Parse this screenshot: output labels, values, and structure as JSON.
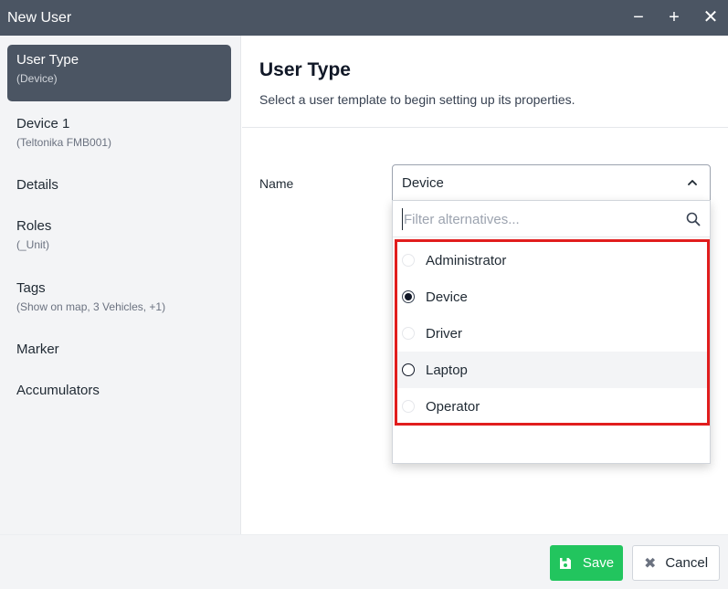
{
  "window": {
    "title": "New User",
    "minimize_label": "−",
    "maximize_label": "+",
    "close_label": "✕"
  },
  "sidebar": {
    "items": [
      {
        "label": "User Type",
        "sub": "(Device)"
      },
      {
        "label": "Device 1",
        "sub": "(Teltonika FMB001)"
      },
      {
        "label": "Details",
        "sub": ""
      },
      {
        "label": "Roles",
        "sub": "(_Unit)"
      },
      {
        "label": "Tags",
        "sub": "(Show on map, 3 Vehicles, +1)"
      },
      {
        "label": "Marker",
        "sub": ""
      },
      {
        "label": "Accumulators",
        "sub": ""
      }
    ]
  },
  "main": {
    "title": "User Type",
    "description": "Select a user template to begin setting up its properties.",
    "name_label": "Name",
    "select_value": "Device",
    "filter_placeholder": "Filter alternatives...",
    "options": [
      {
        "label": "Administrator",
        "state": "unselected"
      },
      {
        "label": "Device",
        "state": "selected"
      },
      {
        "label": "Driver",
        "state": "unselected"
      },
      {
        "label": "Laptop",
        "state": "hover"
      },
      {
        "label": "Operator",
        "state": "unselected"
      }
    ]
  },
  "footer": {
    "save_label": "Save",
    "cancel_label": "Cancel"
  },
  "colors": {
    "titlebar": "#4b5563",
    "active_item": "#4b5563",
    "save_button": "#22c55e",
    "highlight_border": "#e11d1d"
  }
}
